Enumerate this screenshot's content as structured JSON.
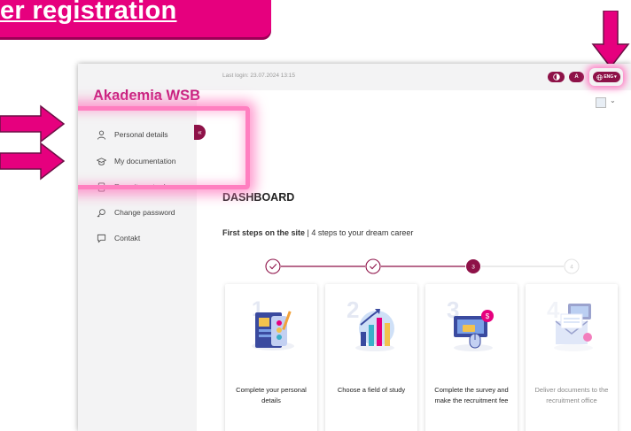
{
  "banner": {
    "text": "er registration",
    "color": "#e6007e"
  },
  "app": {
    "logo": "Akademia WSB",
    "brand_color": "#c4187a",
    "accent_color": "#8e1248",
    "last_login": "Last login: 23.07.2024 13:15",
    "contrast_icon": "contrast-icon",
    "font_size_label": "A",
    "language_label": "ENG",
    "collapse_symbol": "«"
  },
  "sidebar": {
    "items": [
      {
        "label": "Personal details",
        "icon": "user-icon"
      },
      {
        "label": "My documentation",
        "icon": "graduation-cap-icon"
      },
      {
        "label": "Recruitment rules",
        "icon": "document-icon"
      },
      {
        "label": "Change password",
        "icon": "key-icon"
      },
      {
        "label": "Contakt",
        "icon": "chat-icon"
      }
    ]
  },
  "main": {
    "title": "DASHBOARD",
    "steps_heading_bold": "First steps on the site",
    "steps_heading_rest": " | 4 steps to your dream career",
    "stepper": [
      {
        "state": "done",
        "label": "✓"
      },
      {
        "state": "done",
        "label": "✓"
      },
      {
        "state": "current",
        "label": "3"
      },
      {
        "state": "upcoming",
        "label": "4"
      }
    ],
    "cards": [
      {
        "label": "Complete your personal details",
        "state": "active",
        "illustration": "personal-details-illustration"
      },
      {
        "label": "Choose a field of study",
        "state": "active",
        "illustration": "field-of-study-illustration"
      },
      {
        "label": "Complete the survey and make the recruitment fee",
        "state": "active",
        "illustration": "survey-payment-illustration"
      },
      {
        "label": "Deliver documents to the recruitment office",
        "state": "disabled",
        "illustration": "documents-illustration"
      }
    ]
  }
}
